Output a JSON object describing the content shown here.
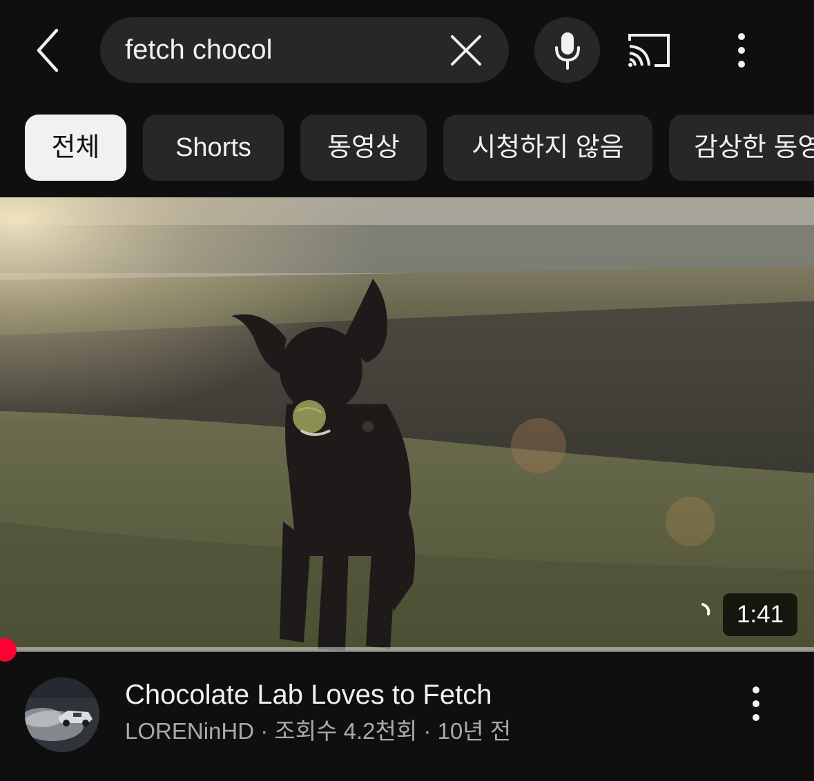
{
  "search": {
    "query": "fetch chocol"
  },
  "icons": {
    "back": "chevron-left-icon",
    "clear": "close-icon",
    "mic": "microphone-icon",
    "cast": "cast-icon",
    "more": "more-vertical-icon"
  },
  "chips": [
    {
      "label": "전체",
      "active": true
    },
    {
      "label": "Shorts",
      "active": false
    },
    {
      "label": "동영상",
      "active": false
    },
    {
      "label": "시청하지 않음",
      "active": false
    },
    {
      "label": "감상한 동영상",
      "active": false
    }
  ],
  "video": {
    "title": "Chocolate Lab Loves to Fetch",
    "channel": "LORENinHD",
    "views": "조회수 4.2천회",
    "age": "10년 전",
    "separator": "·",
    "duration": "1:41",
    "watched_fraction": 0.01
  },
  "colors": {
    "background": "#0f0f0f",
    "surface": "#272727",
    "text_primary": "#f1f1f1",
    "text_secondary": "#aaaaaa",
    "progress": "#ff0033"
  }
}
